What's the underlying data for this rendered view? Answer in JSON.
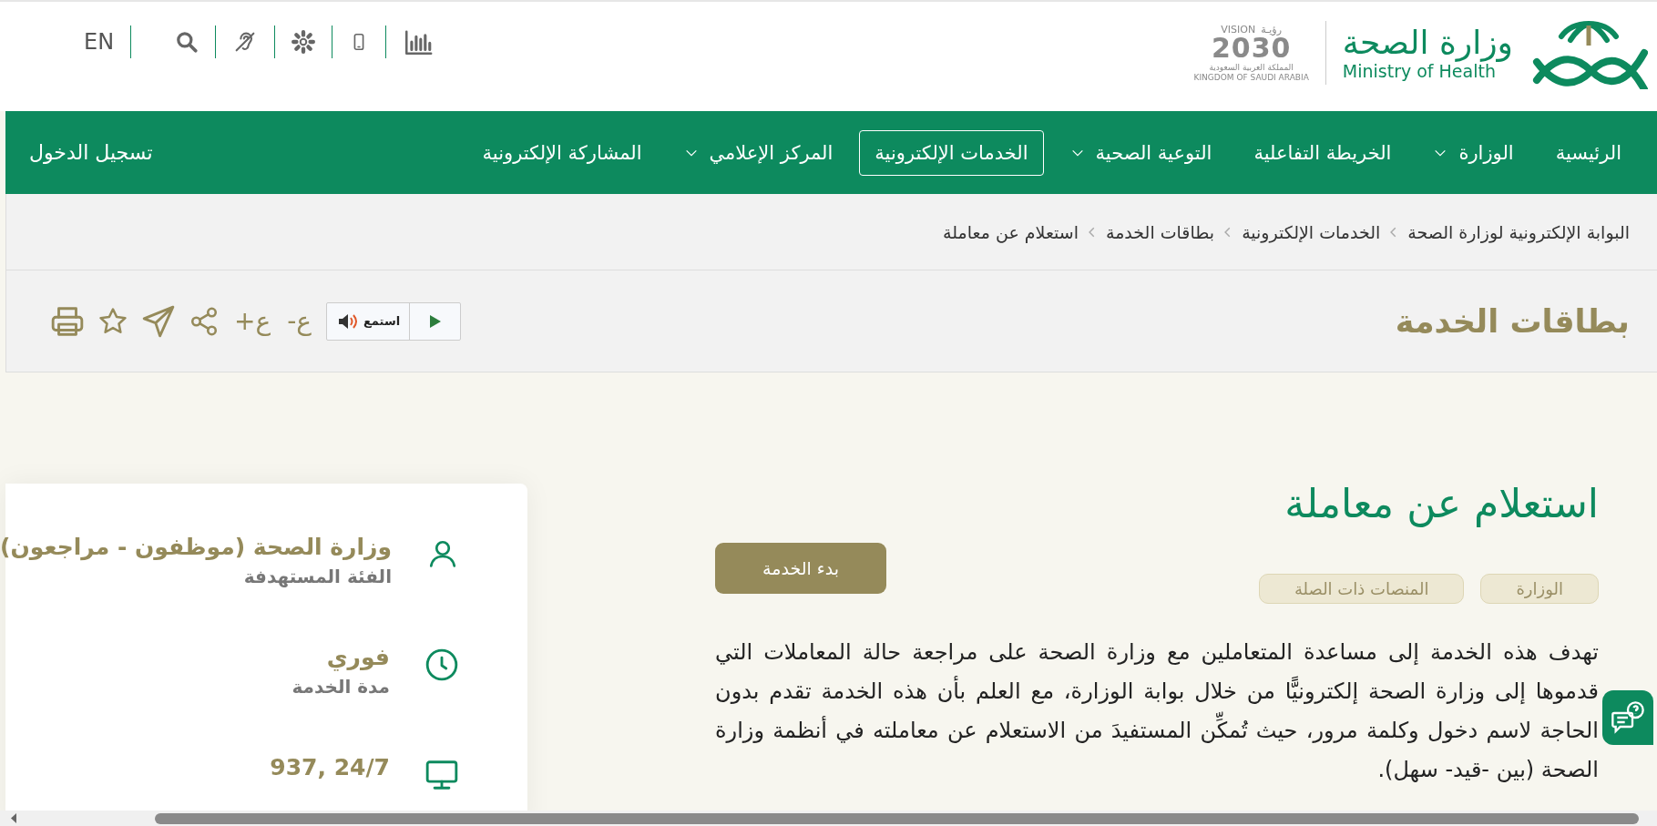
{
  "header": {
    "utility_bar": {
      "language": "EN"
    },
    "logo": {
      "arabic_name": "وزارة الصحة",
      "english_name": "Ministry of Health"
    },
    "vision_logo": {
      "arabic": "رؤيـة",
      "word": "VISION",
      "year": "2030",
      "country_ar": "المملكة العربية السعودية",
      "country_en": "KINGDOM OF SAUDI ARABIA"
    }
  },
  "nav": {
    "items": [
      {
        "label": "الرئيسية",
        "dropdown": false,
        "selected": false
      },
      {
        "label": "الوزارة",
        "dropdown": true,
        "selected": false
      },
      {
        "label": "الخريطة التفاعلية",
        "dropdown": false,
        "selected": false
      },
      {
        "label": "التوعية الصحية",
        "dropdown": true,
        "selected": false
      },
      {
        "label": "الخدمات الإلكترونية",
        "dropdown": false,
        "selected": true
      },
      {
        "label": "المركز الإعلامي",
        "dropdown": true,
        "selected": false
      },
      {
        "label": "المشاركة الإلكترونية",
        "dropdown": false,
        "selected": false
      }
    ],
    "login": "تسجيل الدخول"
  },
  "breadcrumb": [
    "البوابة الإلكترونية لوزارة الصحة",
    "الخدمات الإلكترونية",
    "بطاقات الخدمة",
    "استعلام عن معاملة"
  ],
  "page_title": "بطاقات الخدمة",
  "listen": {
    "label": "استمع"
  },
  "font_controls": [
    "ع-",
    "ع+"
  ],
  "service": {
    "title": "استعلام عن معاملة",
    "start_button": "بدء الخدمة",
    "tags": [
      "الوزارة",
      "المنصات ذات الصلة"
    ],
    "description": "تهدف هذه الخدمة إلى مساعدة المتعاملين مع وزارة الصحة على مراجعة حالة المعاملات التي قدموها إلى وزارة الصحة إلكترونيًّا من خلال بوابة الوزارة، مع العلم بأن هذه الخدمة تقدم بدون الحاجة لاسم دخول وكلمة مرور، حيث تُمكِّن المستفيدَ من الاستعلام عن معاملته في أنظمة وزارة الصحة (بين -قيد- سهل)."
  },
  "info_card": [
    {
      "kind": "person",
      "value": "وزارة الصحة (موظفون - مراجعون)",
      "label": "الفئة المستهدفة"
    },
    {
      "kind": "clock",
      "value": "فوري",
      "label": "مدة الخدمة"
    },
    {
      "kind": "monitor",
      "value": "24/7 ,937"
    }
  ]
}
